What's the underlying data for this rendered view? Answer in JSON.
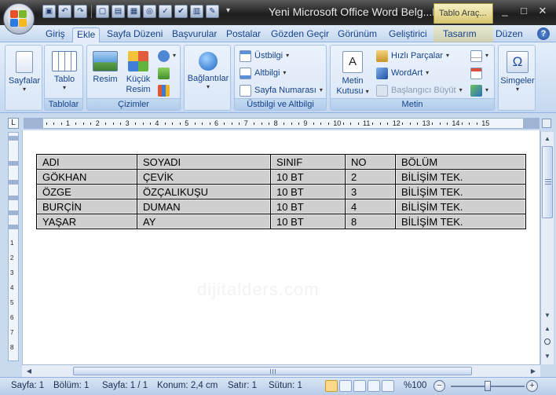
{
  "window": {
    "title": "Yeni Microsoft Office Word Belg...M",
    "context_tab_title": "Tablo Araç...",
    "controls": [
      "_",
      "□",
      "✕"
    ]
  },
  "quick_access": [
    "save-icon",
    "undo-icon",
    "redo-icon",
    "new-icon",
    "open-icon",
    "print-icon",
    "preview-icon",
    "spelling-icon",
    "check-icon",
    "table-icon",
    "format-icon"
  ],
  "tabs": [
    {
      "label": "Giriş"
    },
    {
      "label": "Ekle"
    },
    {
      "label": "Sayfa Düzeni"
    },
    {
      "label": "Başvurular"
    },
    {
      "label": "Postalar"
    },
    {
      "label": "Gözden Geçir"
    },
    {
      "label": "Görünüm"
    },
    {
      "label": "Geliştirici"
    },
    {
      "label": "Tasarım"
    },
    {
      "label": "Düzen"
    }
  ],
  "help_label": "?",
  "ribbon": {
    "groups": {
      "tablolar": "Tablolar",
      "cizimler": "Çizimler",
      "ustbilgi": "Üstbilgi ve Altbilgi",
      "metin": "Metin"
    },
    "buttons": {
      "sayfalar": "Sayfalar",
      "tablo": "Tablo",
      "resim": "Resim",
      "kucuk_resim_1": "Küçük",
      "kucuk_resim_2": "Resim",
      "baglantilar": "Bağlantılar",
      "ustbilgi": "Üstbilgi",
      "altbilgi": "Altbilgi",
      "sayfa_numarasi": "Sayfa Numarası",
      "metin_kutusu_1": "Metin",
      "metin_kutusu_2": "Kutusu",
      "hizli_parcalar": "Hızlı Parçalar",
      "wordart": "WordArt",
      "baslangic_buyut": "Başlangıcı Büyüt",
      "simgeler": "Simgeler"
    }
  },
  "ruler": {
    "corner": "L",
    "h_numbers": [
      "1",
      "2",
      "3",
      "4",
      "5",
      "6",
      "7",
      "8",
      "9",
      "10",
      "11",
      "12",
      "13",
      "14",
      "15"
    ],
    "v_numbers": [
      "1",
      "2",
      "3",
      "4",
      "5",
      "6",
      "7",
      "8"
    ]
  },
  "watermark": "dijitalders.com",
  "table": {
    "rows": [
      [
        "ADI",
        "SOYADI",
        "SINIF",
        "NO",
        "BÖLÜM"
      ],
      [
        "GÖKHAN",
        "ÇEVİK",
        "10 BT",
        "2",
        "BİLİŞİM TEK."
      ],
      [
        "ÖZGE",
        "ÖZÇALIKUŞU",
        "10 BT",
        "3",
        "BİLİŞİM TEK."
      ],
      [
        "BURÇİN",
        "DUMAN",
        "10 BT",
        "4",
        "BİLİŞİM TEK."
      ],
      [
        "YAŞAR",
        "AY",
        "10 BT",
        "8",
        "BİLİŞİM TEK."
      ]
    ]
  },
  "status": {
    "page": "Sayfa: 1",
    "section": "Bölüm: 1",
    "pages": "Sayfa: 1 / 1",
    "position": "Konum: 2,4 cm",
    "line": "Satır: 1",
    "column": "Sütun: 1",
    "zoom": "%100",
    "zoom_level": 0.5
  },
  "colors": {
    "accent": "#15428b",
    "ribbon": "#dbe7f7",
    "cell_fill": "#cfcfcf",
    "context_tab": "#d7c56d"
  }
}
